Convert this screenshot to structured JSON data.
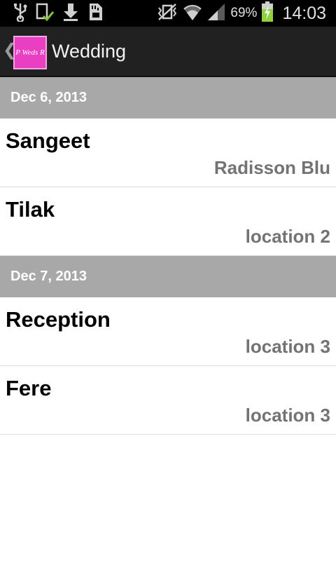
{
  "status_bar": {
    "icons": [
      "usb-icon",
      "sync-done-icon",
      "download-icon",
      "sd-card-icon",
      "vibrate-mute-icon",
      "wifi-icon",
      "signal-icon",
      "battery-charging-icon"
    ],
    "battery_percent": "69%",
    "time": "14:03"
  },
  "action_bar": {
    "logo_text": "P Weds R",
    "title": "Wedding"
  },
  "groups": [
    {
      "date": "Dec 6, 2013",
      "events": [
        {
          "name": "Sangeet",
          "location": "Radisson Blu"
        },
        {
          "name": "Tilak",
          "location": "location 2"
        }
      ]
    },
    {
      "date": "Dec 7, 2013",
      "events": [
        {
          "name": "Reception",
          "location": "location 3"
        },
        {
          "name": "Fere",
          "location": "location 3"
        }
      ]
    }
  ],
  "colors": {
    "status_bar_bg": "#000000",
    "action_bar_bg": "#212121",
    "section_header_bg": "#a8a8a8",
    "logo_bg": "#e83fc3",
    "location_text": "#737373",
    "battery_green": "#8fd13f"
  }
}
